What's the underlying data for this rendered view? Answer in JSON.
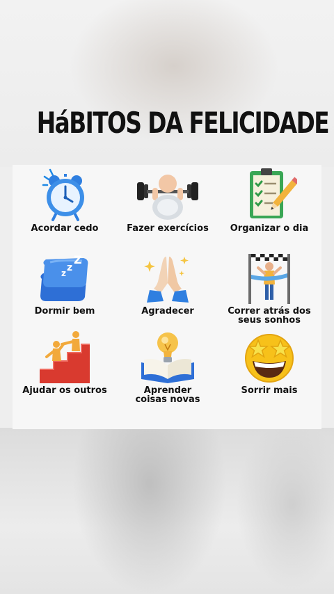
{
  "title": {
    "part1": "Há",
    "part2": "BITOS DA FELICIDADE"
  },
  "habits": [
    {
      "label": "Acordar cedo",
      "icon": "alarm-clock-icon"
    },
    {
      "label": "Fazer exercícios",
      "icon": "dumbbell-lifting-icon"
    },
    {
      "label": "Organizar o dia",
      "icon": "checklist-clipboard-icon"
    },
    {
      "label": "Dormir bem",
      "icon": "sleeping-pillow-icon"
    },
    {
      "label": "Agradecer",
      "icon": "praying-hands-icon"
    },
    {
      "label": "Correr atrás dos\nseus sonhos",
      "icon": "finish-line-runner-icon"
    },
    {
      "label": "Ajudar os outros",
      "icon": "helping-hand-stairs-icon"
    },
    {
      "label": "Aprender\ncoisas novas",
      "icon": "lightbulb-book-icon"
    },
    {
      "label": "Sorrir mais",
      "icon": "star-struck-smiley-icon"
    }
  ]
}
